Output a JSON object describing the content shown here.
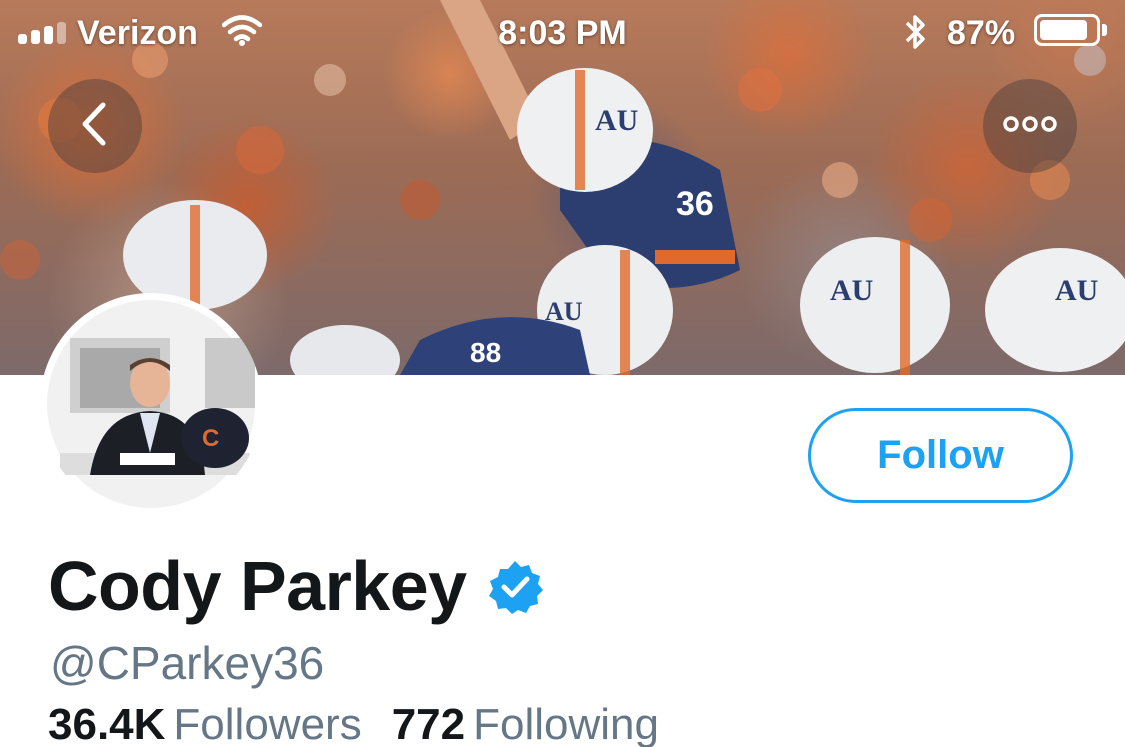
{
  "status_bar": {
    "carrier": "Verizon",
    "time": "8:03 PM",
    "battery_percent": "87%",
    "battery_level": 0.87
  },
  "nav": {
    "back_icon": "chevron-left-icon",
    "more_icon": "more-horizontal-icon"
  },
  "profile": {
    "display_name": "Cody Parkey",
    "verified": true,
    "handle": "@CParkey36",
    "follow_label": "Follow"
  },
  "stats": {
    "followers_count": "36.4K",
    "followers_label": "Followers",
    "following_count": "772",
    "following_label": "Following"
  },
  "colors": {
    "accent": "#1da1f2",
    "text_primary": "#14171a",
    "text_secondary": "#657786"
  }
}
